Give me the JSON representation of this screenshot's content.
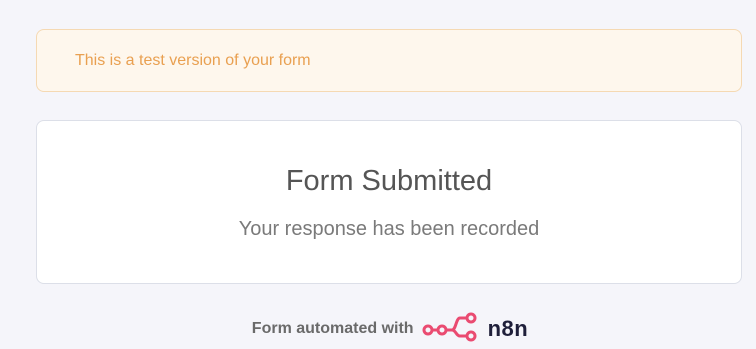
{
  "banner": {
    "text": "This is a test version of your form"
  },
  "card": {
    "title": "Form Submitted",
    "subtitle": "Your response has been recorded"
  },
  "footer": {
    "text": "Form automated with",
    "brand_name": "n8n",
    "brand_icon": "n8n-logo-icon"
  },
  "colors": {
    "banner_text": "#e9a051",
    "banner_bg": "#fef7ed",
    "brand_pink": "#ea4b71",
    "brand_dark": "#1f1f3a"
  }
}
